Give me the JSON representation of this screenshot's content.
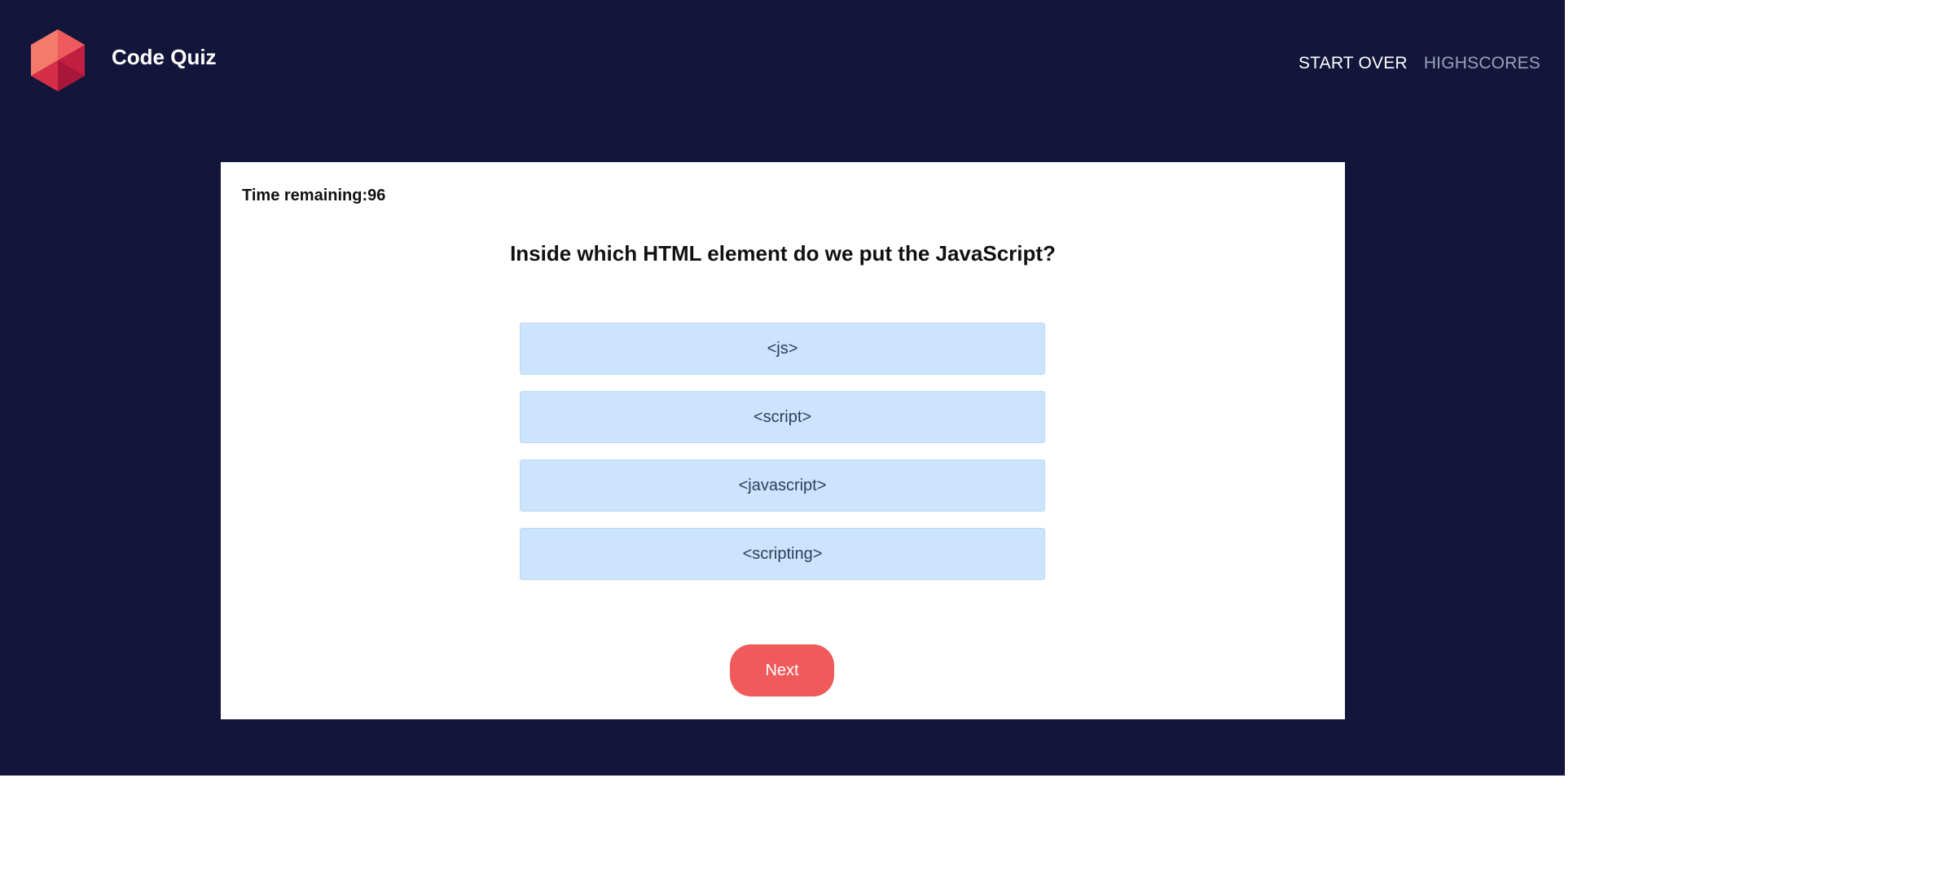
{
  "brand": {
    "name": "Code Quiz",
    "logo_icon": "red-gem-icon",
    "colors": {
      "light": "#f47a6a",
      "mid": "#e84556",
      "dark": "#b8183a"
    }
  },
  "nav": {
    "items": [
      {
        "label": "START OVER",
        "state": "active"
      },
      {
        "label": "HIGHSCORES",
        "state": "inactive"
      }
    ]
  },
  "quiz": {
    "timer_text": "Time remaining:96",
    "question": "Inside which HTML element do we put the JavaScript?",
    "choices": [
      "<js>",
      "<script>",
      "<javascript>",
      "<scripting>"
    ],
    "next_label": "Next"
  },
  "colors": {
    "background": "#13163a",
    "card": "#ffffff",
    "choice_bg": "#cce5fc",
    "accent": "#f05a5a"
  }
}
